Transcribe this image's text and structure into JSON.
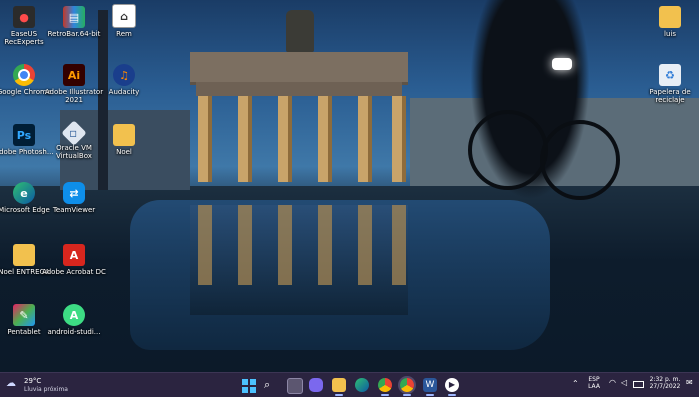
{
  "desktop_icons": [
    {
      "label": "EaseUS RecExperts",
      "icon": "easeus-recexperts-icon"
    },
    {
      "label": "RetroBar.64-bit",
      "icon": "retrobar-archive-icon"
    },
    {
      "label": "Rem",
      "icon": "app-shortcut-icon"
    },
    {
      "label": "Google Chrome",
      "icon": "chrome-icon"
    },
    {
      "label": "Adobe Illustrator 2021",
      "icon": "illustrator-icon"
    },
    {
      "label": "Audacity",
      "icon": "audacity-icon"
    },
    {
      "label": "Adobe Photosh...",
      "icon": "photoshop-icon"
    },
    {
      "label": "Oracle VM VirtualBox",
      "icon": "virtualbox-icon"
    },
    {
      "label": "Noel",
      "icon": "folder-icon"
    },
    {
      "label": "Microsoft Edge",
      "icon": "edge-icon"
    },
    {
      "label": "TeamViewer",
      "icon": "teamviewer-icon"
    },
    {
      "label": "Noel ENTREGA",
      "icon": "folder-icon"
    },
    {
      "label": "Adobe Acrobat DC",
      "icon": "acrobat-icon"
    },
    {
      "label": "Pentablet",
      "icon": "pentablet-icon"
    },
    {
      "label": "android-studi...",
      "icon": "android-studio-icon"
    },
    {
      "label": "luis",
      "icon": "folder-icon"
    },
    {
      "label": "Papelera de reciclaje",
      "icon": "recycle-bin-icon"
    }
  ],
  "taskbar": {
    "weather": {
      "temp": "29°C",
      "condition": "Lluvia próxima"
    },
    "language": {
      "lang": "ESP",
      "layout": "LAA"
    },
    "clock": {
      "time": "2:32 p. m.",
      "date": "27/7/2022"
    },
    "apps": [
      "windows-start-icon",
      "search-icon",
      "task-view-icon",
      "teams-chat-icon",
      "file-explorer-icon",
      "edge-icon",
      "chrome-icon",
      "chrome-profile-icon",
      "word-icon",
      "media-player-icon"
    ]
  },
  "colors": {
    "taskbar_bg": "#2b2440",
    "folder": "#f2c14e",
    "accent": "#9fb7ff"
  }
}
